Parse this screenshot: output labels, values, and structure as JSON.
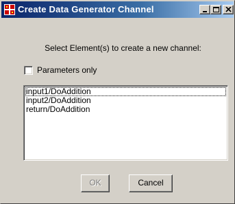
{
  "window": {
    "title": "Create Data Generator Channel",
    "icon": "app-icon",
    "controls": {
      "minimize_icon": "minimize-icon",
      "maximize_icon": "maximize-icon",
      "close_icon": "close-icon"
    }
  },
  "dialog": {
    "prompt": "Select Element(s) to create a new channel:",
    "parameters_only": {
      "label": "Parameters only",
      "checked": false
    },
    "elements": [
      {
        "label": "input1/DoAddition"
      },
      {
        "label": "input2/DoAddition"
      },
      {
        "label": "return/DoAddition"
      }
    ],
    "buttons": {
      "ok_label": "OK",
      "ok_enabled": false,
      "cancel_label": "Cancel"
    }
  },
  "colors": {
    "title_gradient_start": "#0a246a",
    "title_gradient_end": "#a6caf0",
    "face": "#d4d0c8",
    "disabled_text": "#808080"
  }
}
